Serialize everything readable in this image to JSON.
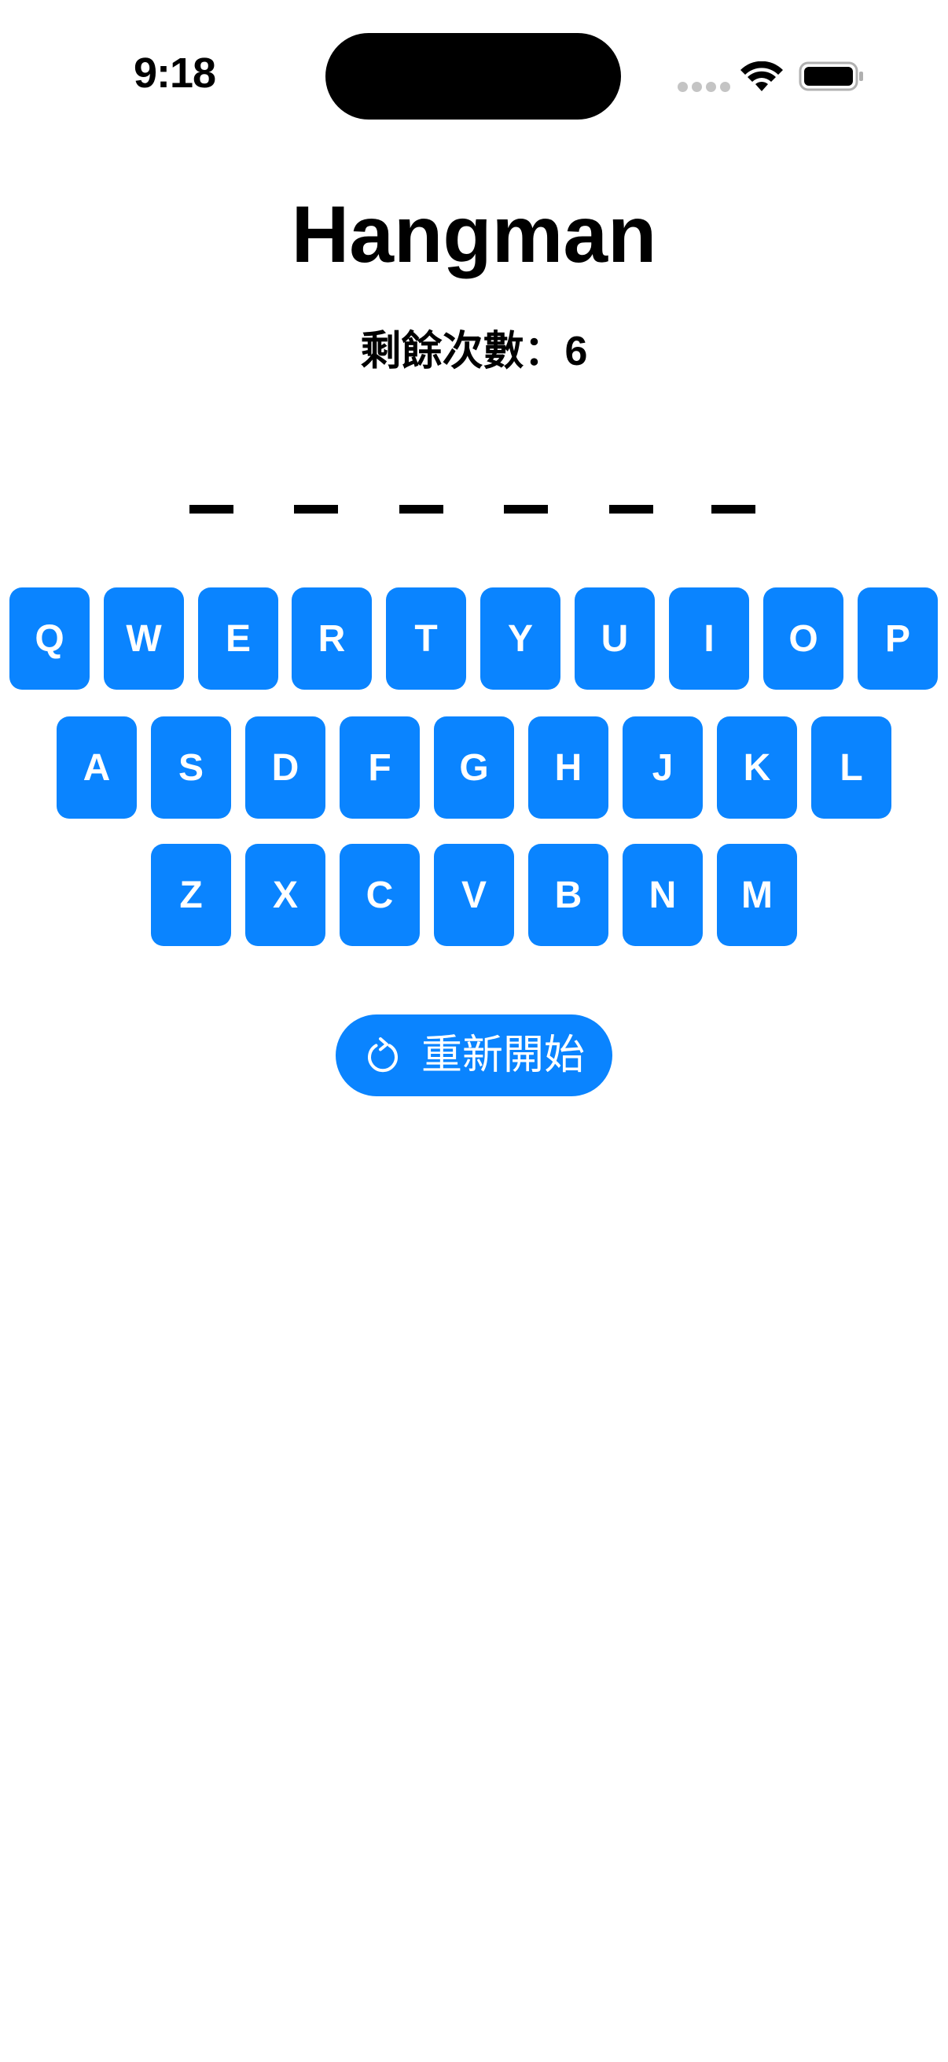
{
  "status_bar": {
    "time": "9:18",
    "icons": [
      "cellular-dots-icon",
      "wifi-icon",
      "battery-icon"
    ]
  },
  "game": {
    "title": "Hangman",
    "remaining_label": "剩餘次數：6",
    "blank_count": 6
  },
  "keyboard": {
    "row1": [
      "Q",
      "W",
      "E",
      "R",
      "T",
      "Y",
      "U",
      "I",
      "O",
      "P"
    ],
    "row2": [
      "A",
      "S",
      "D",
      "F",
      "G",
      "H",
      "J",
      "K",
      "L"
    ],
    "row3": [
      "Z",
      "X",
      "C",
      "V",
      "B",
      "N",
      "M"
    ]
  },
  "restart_button": {
    "label": "重新開始",
    "icon": "arrow-clockwise-icon"
  },
  "colors": {
    "accent": "#0a84ff",
    "text": "#000000",
    "background": "#ffffff"
  }
}
